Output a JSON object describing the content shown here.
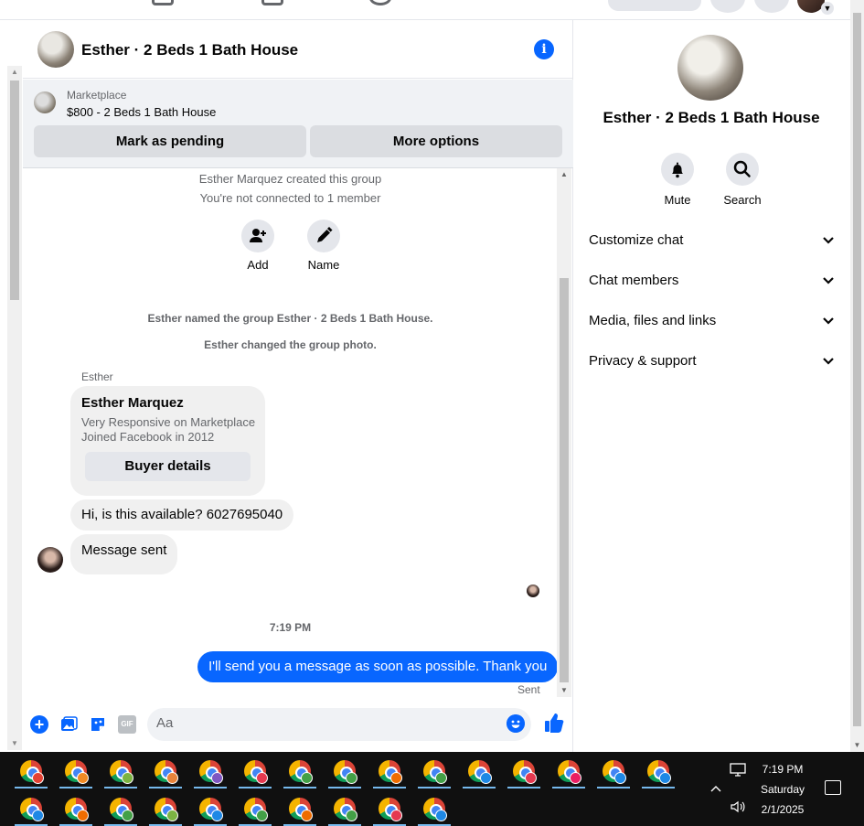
{
  "chat": {
    "title": "Esther · 2 Beds 1 Bath House",
    "marketplace_label": "Marketplace",
    "listing": "$800 - 2 Beds 1 Bath House",
    "mark_pending_label": "Mark as pending",
    "more_options_label": "More options",
    "system": {
      "created": "Esther Marquez created this group",
      "not_connected": "You're not connected to 1 member",
      "named": "Esther named the group Esther · 2 Beds 1 Bath House.",
      "changed_photo": "Esther changed the group photo."
    },
    "actions": {
      "add": "Add",
      "name": "Name"
    },
    "sender_short": "Esther",
    "buyer_card": {
      "name": "Esther Marquez",
      "line1": "Very Responsive on Marketplace",
      "line2": "Joined Facebook in 2012",
      "button": "Buyer details"
    },
    "incoming": [
      "Hi, is this available? 6027695040",
      "Message sent"
    ],
    "timestamp": "7:19 PM",
    "outgoing": "I'll send you a message as soon as possible. Thank you",
    "status": "Sent",
    "composer_placeholder": "Aa",
    "gif_label": "GIF"
  },
  "details": {
    "title": "Esther · 2 Beds 1 Bath House",
    "mute": "Mute",
    "search": "Search",
    "rows": [
      "Customize chat",
      "Chat members",
      "Media, files and links",
      "Privacy & support"
    ]
  },
  "taskbar": {
    "time": "7:19 PM",
    "day": "Saturday",
    "date": "2/1/2025",
    "badge_colors": [
      "#e34234",
      "#f08a24",
      "#7cb342",
      "#e8833a",
      "#7e57c2",
      "#e53950",
      "#43a047",
      "#43a047",
      "#ef6c00",
      "#43a047",
      "#1e88e5",
      "#e53950",
      "#e91e63",
      "#1e88e5",
      "#1e88e5",
      "#1e88e5",
      "#ef6c00",
      "#43a047",
      "#7cb342",
      "#1e88e5",
      "#43a047",
      "#ef6c00",
      "#43a047",
      "#e53950",
      "#1e88e5"
    ],
    "accent": "#76b9ed"
  },
  "colors": {
    "brand": "#0866ff",
    "bubble_in": "#f0f0f0"
  }
}
